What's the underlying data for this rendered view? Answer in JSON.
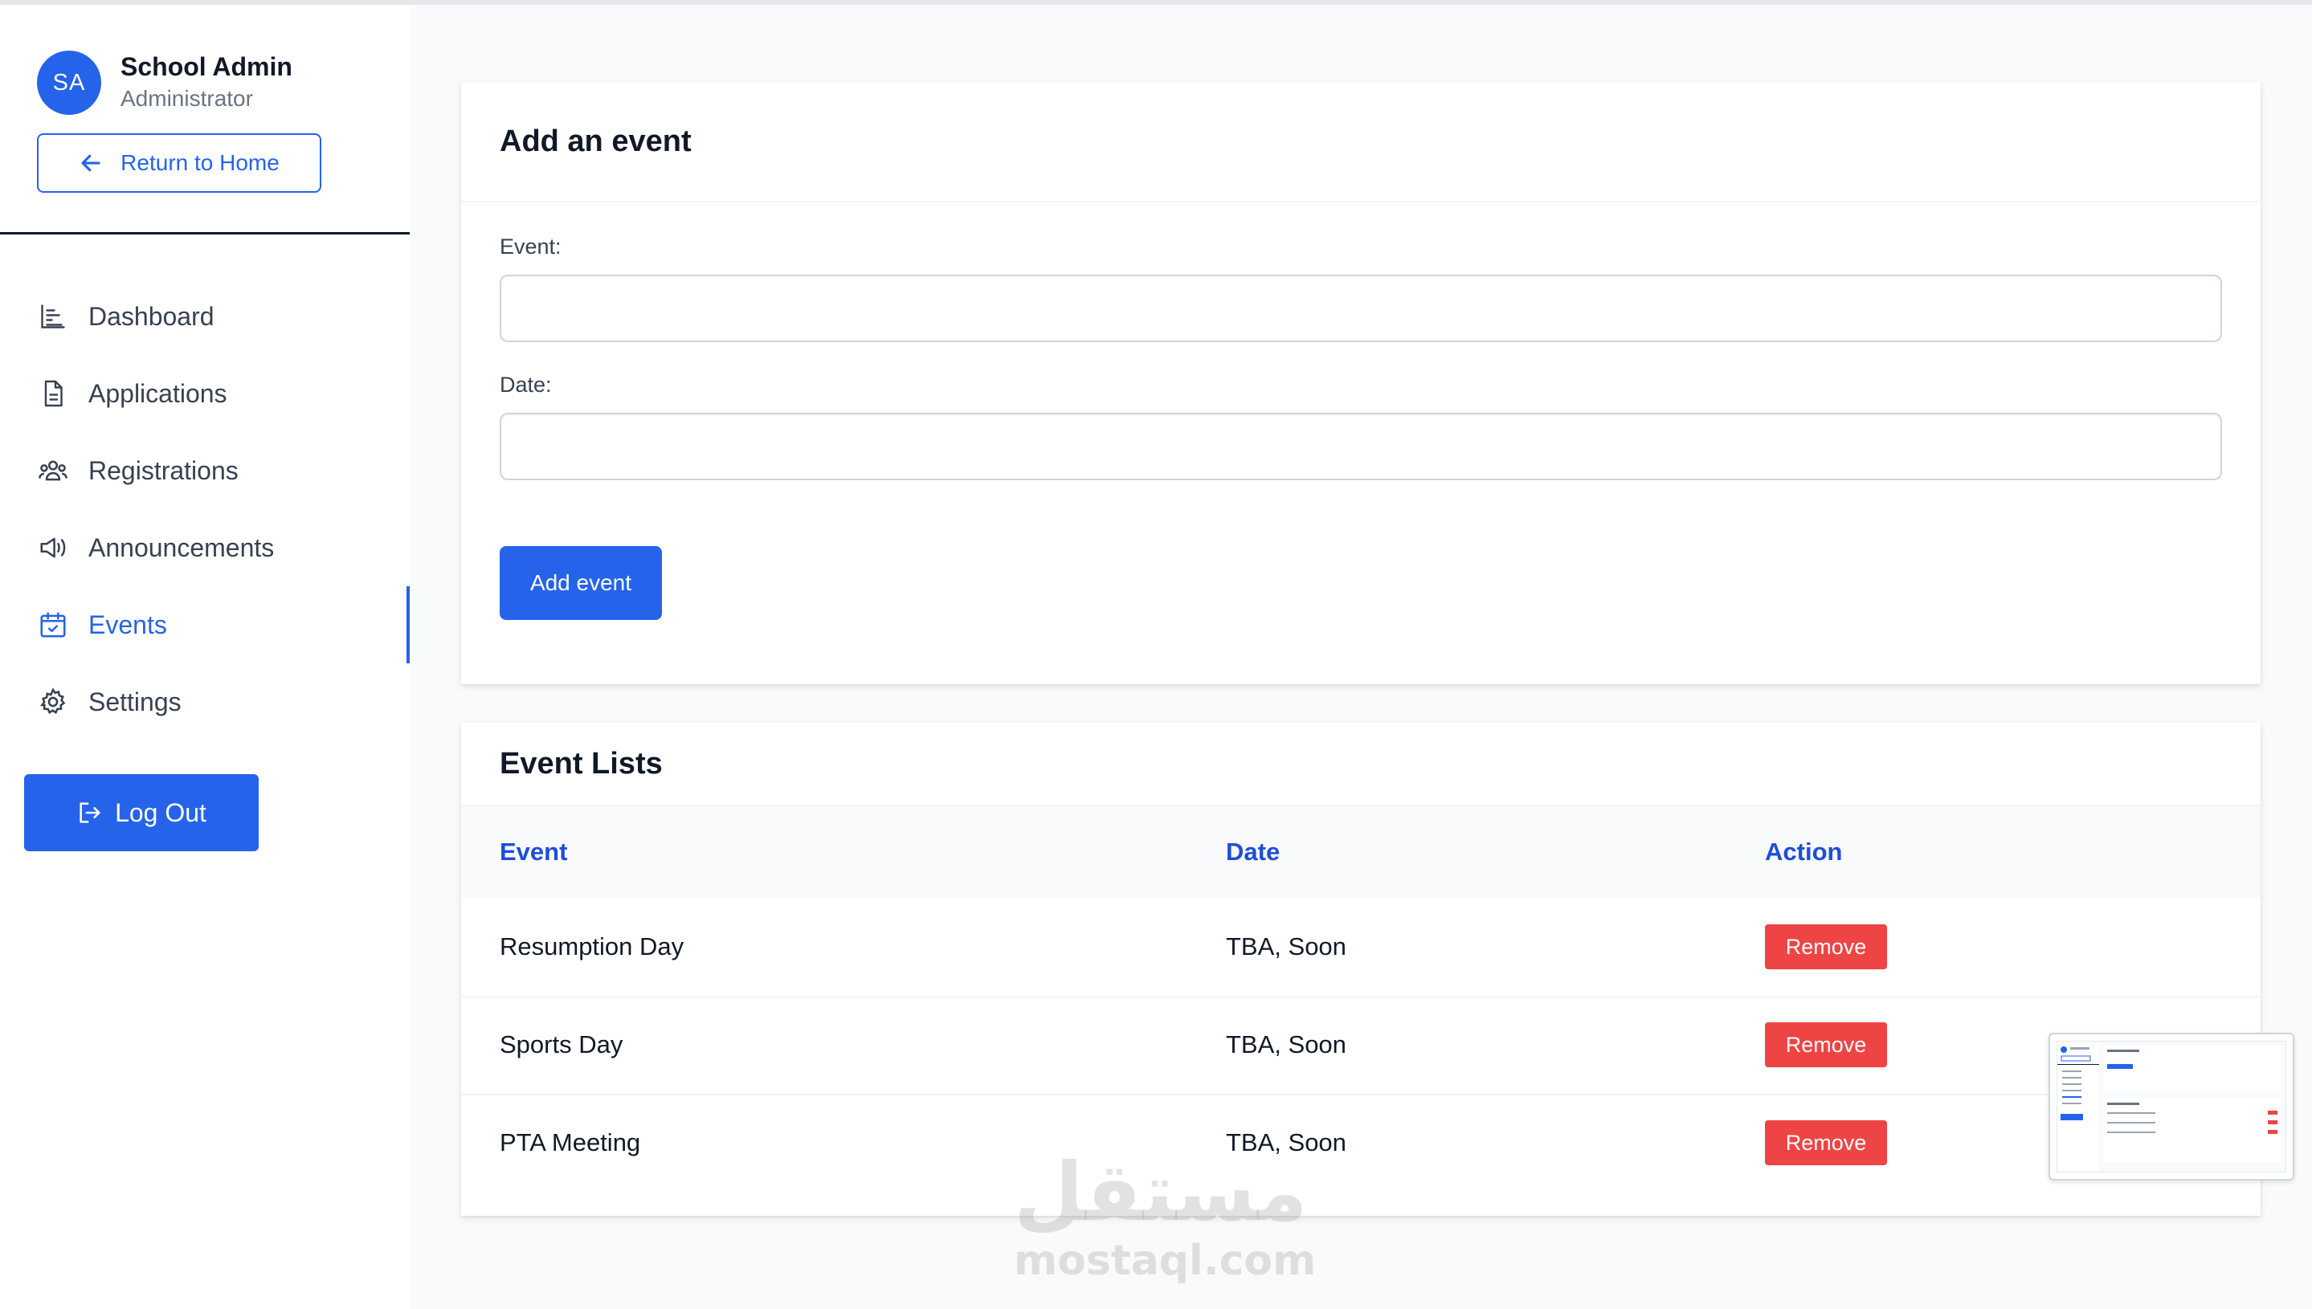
{
  "user": {
    "initials": "SA",
    "name": "School Admin",
    "role": "Administrator"
  },
  "sidebar": {
    "return_home_label": "Return to Home",
    "items": [
      {
        "label": "Dashboard",
        "icon": "bar-chart-icon"
      },
      {
        "label": "Applications",
        "icon": "document-icon"
      },
      {
        "label": "Registrations",
        "icon": "users-icon"
      },
      {
        "label": "Announcements",
        "icon": "megaphone-icon"
      },
      {
        "label": "Events",
        "icon": "calendar-check-icon",
        "active": true
      },
      {
        "label": "Settings",
        "icon": "gear-icon"
      }
    ],
    "logout_label": "Log Out"
  },
  "form": {
    "title": "Add an event",
    "event_label": "Event:",
    "event_value": "",
    "date_label": "Date:",
    "date_value": "",
    "submit_label": "Add event"
  },
  "list": {
    "title": "Event Lists",
    "columns": [
      "Event",
      "Date",
      "Action"
    ],
    "rows": [
      {
        "event": "Resumption Day",
        "date": "TBA, Soon",
        "action": "Remove"
      },
      {
        "event": "Sports Day",
        "date": "TBA, Soon",
        "action": "Remove"
      },
      {
        "event": "PTA Meeting",
        "date": "TBA, Soon",
        "action": "Remove"
      }
    ]
  },
  "watermark": {
    "arabic": "مستقل",
    "latin": "mostaql.com"
  },
  "colors": {
    "primary": "#2563eb",
    "danger": "#ef4444",
    "header_text": "#1d4ed8"
  }
}
